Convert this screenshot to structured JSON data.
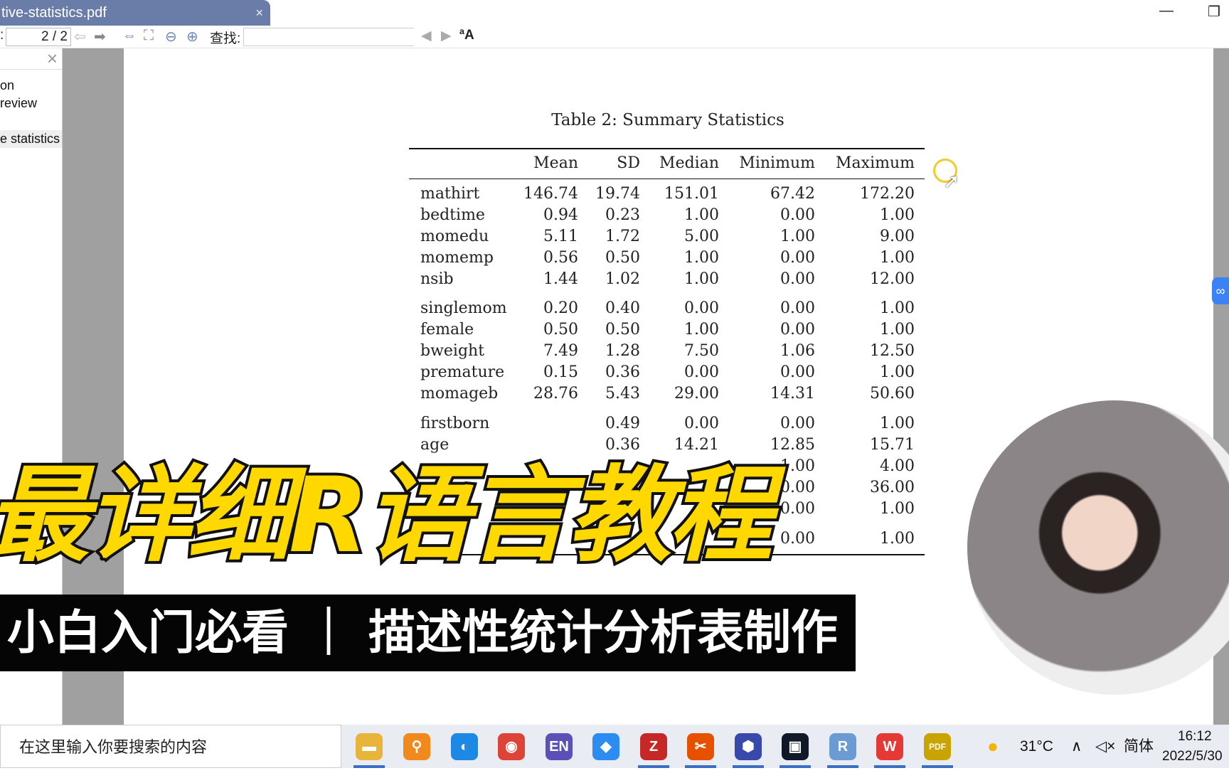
{
  "window": {
    "tab_title": "tive-statistics.pdf",
    "close": "×",
    "minimize": "—",
    "restore": "❐"
  },
  "toolbar": {
    "page_label": ":",
    "page_value": "2 / 2",
    "find_label": "查找:",
    "find_value": ""
  },
  "sidebar": {
    "close": "×",
    "items": [
      "on",
      "review",
      "",
      "e statistics"
    ]
  },
  "table": {
    "title": "Table 2: Summary Statistics",
    "columns": [
      "Mean",
      "SD",
      "Median",
      "Minimum",
      "Maximum"
    ],
    "rows": [
      {
        "name": "mathirt",
        "values": [
          "146.74",
          "19.74",
          "151.01",
          "67.42",
          "172.20"
        ]
      },
      {
        "name": "bedtime",
        "values": [
          "0.94",
          "0.23",
          "1.00",
          "0.00",
          "1.00"
        ]
      },
      {
        "name": "momedu",
        "values": [
          "5.11",
          "1.72",
          "5.00",
          "1.00",
          "9.00"
        ]
      },
      {
        "name": "momemp",
        "values": [
          "0.56",
          "0.50",
          "1.00",
          "0.00",
          "1.00"
        ]
      },
      {
        "name": "nsib",
        "values": [
          "1.44",
          "1.02",
          "1.00",
          "0.00",
          "12.00"
        ]
      },
      {
        "name": "singlemom",
        "values": [
          "0.20",
          "0.40",
          "0.00",
          "0.00",
          "1.00"
        ]
      },
      {
        "name": "female",
        "values": [
          "0.50",
          "0.50",
          "1.00",
          "0.00",
          "1.00"
        ]
      },
      {
        "name": "bweight",
        "values": [
          "7.49",
          "1.28",
          "7.50",
          "1.06",
          "12.50"
        ]
      },
      {
        "name": "premature",
        "values": [
          "0.15",
          "0.36",
          "0.00",
          "0.00",
          "1.00"
        ]
      },
      {
        "name": "momageb",
        "values": [
          "28.76",
          "5.43",
          "29.00",
          "14.31",
          "50.60"
        ]
      },
      {
        "name": "firstborn",
        "values": [
          "",
          "0.49",
          "0.00",
          "0.00",
          "1.00"
        ]
      },
      {
        "name": "age",
        "values": [
          "",
          "0.36",
          "14.21",
          "12.85",
          "15.71"
        ]
      },
      {
        "name": "",
        "values": [
          "",
          "",
          "",
          "1.00",
          "4.00"
        ]
      },
      {
        "name": "",
        "values": [
          "",
          "",
          "",
          "0.00",
          "36.00"
        ]
      },
      {
        "name": "",
        "values": [
          "",
          "",
          "",
          "0.00",
          "1.00"
        ]
      },
      {
        "name": "",
        "values": [
          "",
          "",
          "",
          "0.00",
          "1.00"
        ]
      }
    ]
  },
  "overlay": {
    "title": "最详细R语言教程",
    "subtitle": "小白入门必看 ｜ 描述性统计分析表制作"
  },
  "taskbar": {
    "search_placeholder": "在这里输入你要搜索的内容",
    "weather": "31°C",
    "ime": "简体",
    "volume": "◁×",
    "chevron": "∧",
    "time": "16:12",
    "date": "2022/5/30",
    "apps": [
      {
        "icon": "file-explorer-icon",
        "glyph": "▬",
        "color": "#e8b43a"
      },
      {
        "icon": "search-app-icon",
        "glyph": "⚲",
        "color": "#f08a1c"
      },
      {
        "icon": "browser-icon",
        "glyph": "◐",
        "color": "#1e88e5"
      },
      {
        "icon": "chrome-icon",
        "glyph": "◉",
        "color": "#db4437"
      },
      {
        "icon": "en-dictionary-icon",
        "glyph": "EN",
        "color": "#5b4fb8"
      },
      {
        "icon": "notes-icon",
        "glyph": "◆",
        "color": "#2d8cf0"
      },
      {
        "icon": "zotero-icon",
        "glyph": "Z",
        "color": "#c62828"
      },
      {
        "icon": "scissors-icon",
        "glyph": "✂",
        "color": "#e65100"
      },
      {
        "icon": "app-icon",
        "glyph": "⬢",
        "color": "#3949ab"
      },
      {
        "icon": "camera-icon",
        "glyph": "▣",
        "color": "#111827"
      },
      {
        "icon": "r-icon",
        "glyph": "R",
        "color": "#6b9bd2"
      },
      {
        "icon": "wps-icon",
        "glyph": "W",
        "color": "#e53935"
      },
      {
        "icon": "pdf-icon",
        "glyph": "PDF",
        "color": "#c9a400"
      }
    ]
  }
}
